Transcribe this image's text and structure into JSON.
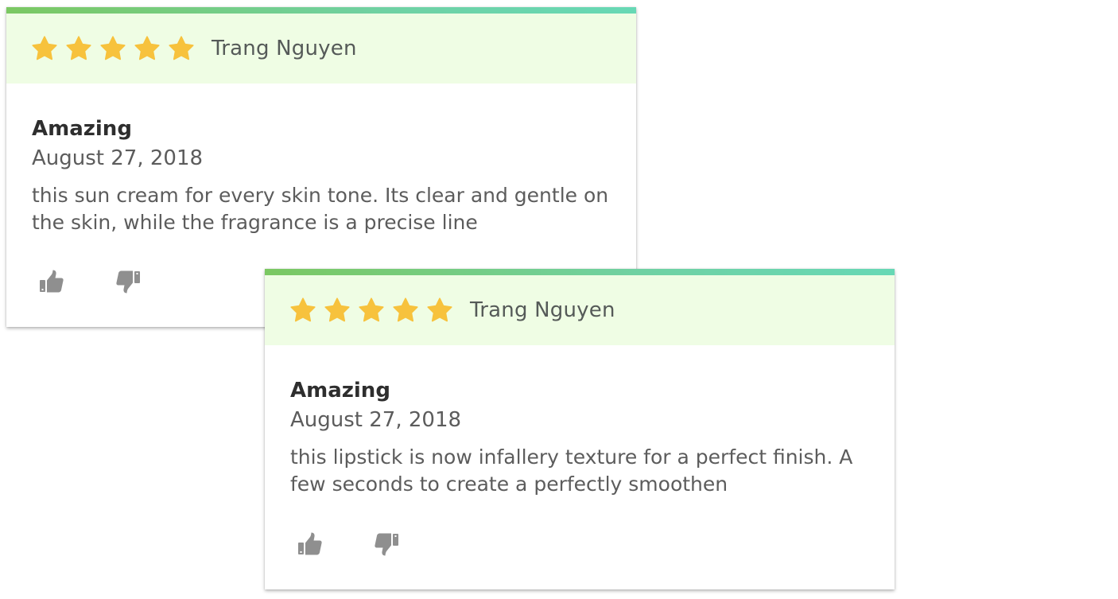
{
  "colors": {
    "accent_start": "#7bc862",
    "accent_end": "#67d8b5",
    "header_bg": "#effde4",
    "star": "#f7c23d",
    "action_icon": "#8f8f8f"
  },
  "reviews": [
    {
      "rating": 5,
      "max_rating": 5,
      "reviewer": "Trang Nguyen",
      "title": "Amazing",
      "date": "August 27, 2018",
      "text": "this sun cream for every skin tone. Its clear and gentle on the skin, while the fragrance is a precise line",
      "icons": {
        "like": "thumbs-up-icon",
        "dislike": "thumbs-down-icon"
      }
    },
    {
      "rating": 5,
      "max_rating": 5,
      "reviewer": "Trang Nguyen",
      "title": "Amazing",
      "date": "August 27, 2018",
      "text": "this lipstick is now infallery texture for a perfect finish. A few seconds to create a perfectly smoothen",
      "icons": {
        "like": "thumbs-up-icon",
        "dislike": "thumbs-down-icon"
      }
    }
  ]
}
